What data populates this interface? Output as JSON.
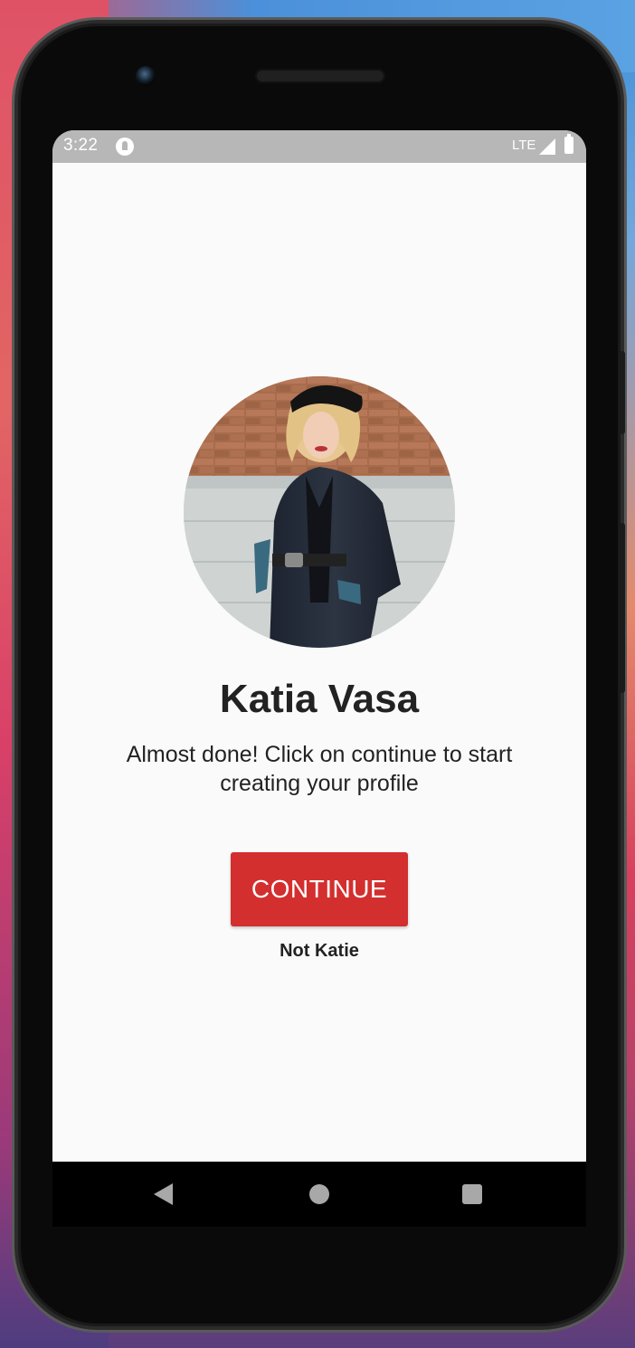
{
  "status_bar": {
    "time": "3:22",
    "network": "LTE",
    "icons": [
      "app-notification-icon",
      "signal-icon",
      "battery-icon"
    ]
  },
  "profile": {
    "name": "Katia Vasa",
    "message": "Almost done! Click on continue to start creating your profile",
    "avatar_icon": "profile-photo"
  },
  "actions": {
    "continue_label": "CONTINUE",
    "not_user_label": "Not Katie"
  },
  "navigation": {
    "buttons": [
      "back-icon",
      "home-icon",
      "recents-icon"
    ]
  },
  "colors": {
    "primary": "#d32f2f",
    "status_bar": "#b7b7b7",
    "background": "#fafafa",
    "text": "#222222"
  }
}
